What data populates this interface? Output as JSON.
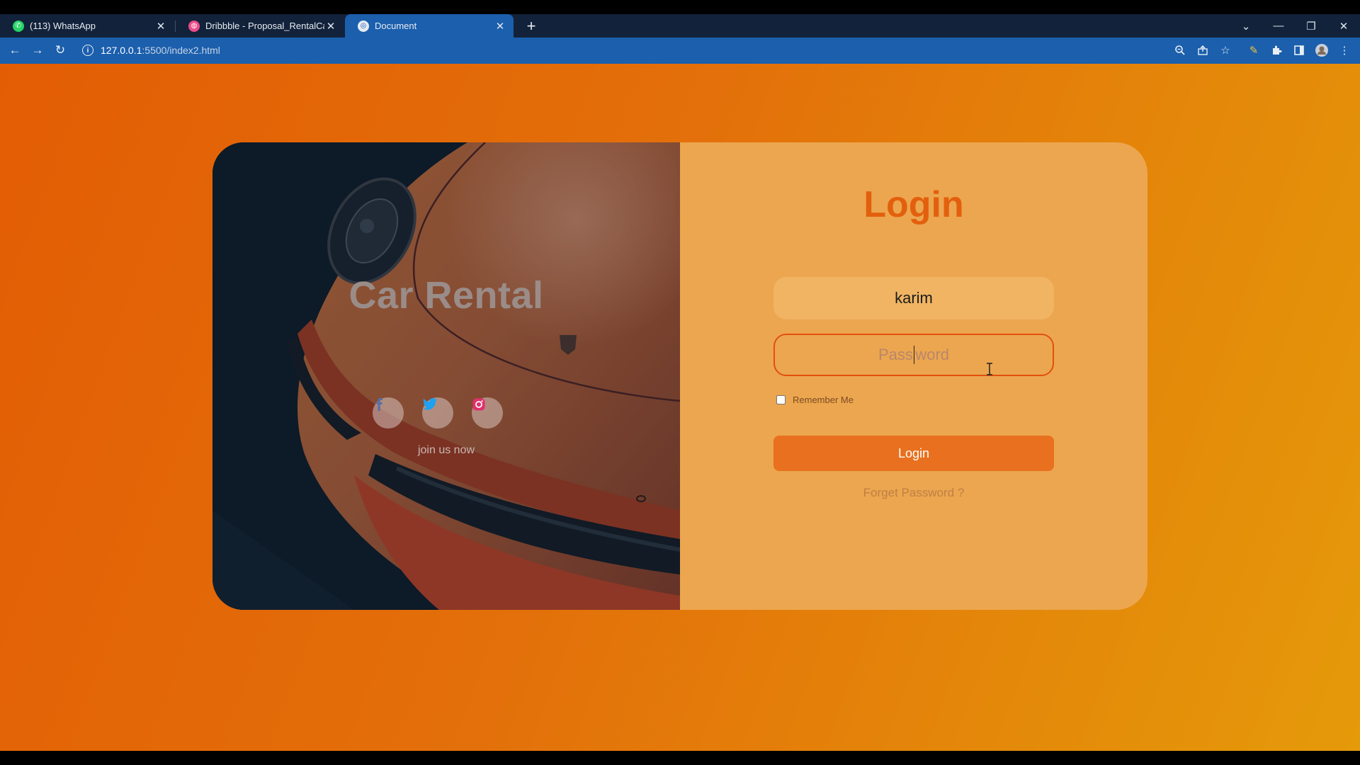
{
  "browser": {
    "tabs": [
      {
        "title": "(113) WhatsApp",
        "icon": "whatsapp-icon"
      },
      {
        "title": "Dribbble - Proposal_RentalCar.pn",
        "icon": "dribbble-icon"
      },
      {
        "title": "Document",
        "icon": "globe-icon"
      }
    ],
    "url_host": "127.0.0.1",
    "url_path": ":5500/index2.html",
    "colors": {
      "chrome": "#12223a",
      "toolbar": "#1b5fad"
    }
  },
  "hero": {
    "title": "Car Rental",
    "social": [
      "facebook-icon",
      "twitter-icon",
      "instagram-icon"
    ],
    "join_text": "join us now"
  },
  "login": {
    "title": "Login",
    "username_value": "karim",
    "password_placeholder_a": "Pass",
    "password_placeholder_b": "word",
    "remember_label": "Remember Me",
    "button_label": "Login",
    "forgot_link": "Forget Password ?"
  },
  "colors": {
    "accent": "#e2600d",
    "panel": "#eca64f",
    "button": "#e8701e"
  }
}
